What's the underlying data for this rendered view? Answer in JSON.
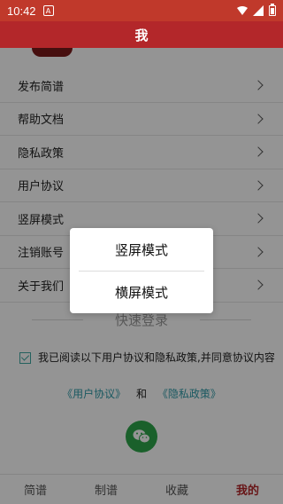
{
  "status_bar": {
    "time": "10:42",
    "notification_icon": "A"
  },
  "header": {
    "title": "我"
  },
  "menu": {
    "items": [
      {
        "label": "发布简谱"
      },
      {
        "label": "帮助文档"
      },
      {
        "label": "隐私政策"
      },
      {
        "label": "用户协议"
      },
      {
        "label": "竖屏模式"
      },
      {
        "label": "注销账号"
      },
      {
        "label": "关于我们"
      }
    ]
  },
  "login": {
    "title": "快速登录",
    "agreement_text": "我已阅读以下用户协议和隐私政策,并同意协议内容",
    "user_agreement_link": "《用户协议》",
    "and_text": "和",
    "privacy_link": "《隐私政策》"
  },
  "tabs": [
    {
      "label": "简谱"
    },
    {
      "label": "制谱"
    },
    {
      "label": "收藏"
    },
    {
      "label": "我的"
    }
  ],
  "dialog": {
    "options": [
      {
        "label": "竖屏模式"
      },
      {
        "label": "横屏模式"
      }
    ]
  },
  "colors": {
    "brand_red": "#b3272a",
    "status_red": "#c0392b",
    "link_teal": "#2e9aa8",
    "wechat_green": "#2ea54a"
  }
}
